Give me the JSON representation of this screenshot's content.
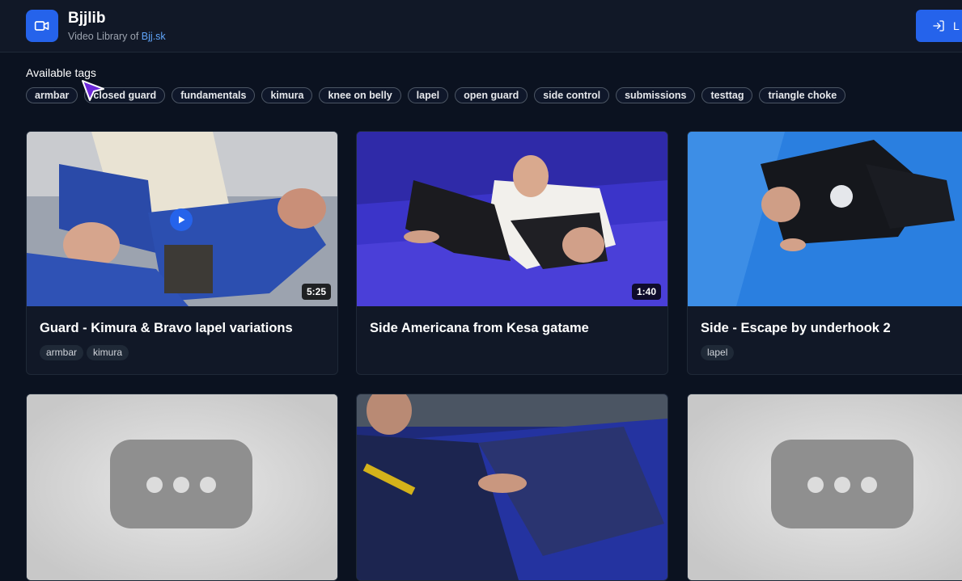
{
  "app": {
    "title": "Bjjlib",
    "subtitle_prefix": "Video Library of ",
    "subtitle_link": "Bjj.sk",
    "login_label": "L"
  },
  "tags": {
    "heading": "Available tags",
    "items": [
      "armbar",
      "closed guard",
      "fundamentals",
      "kimura",
      "knee on belly",
      "lapel",
      "open guard",
      "side control",
      "submissions",
      "testtag",
      "triangle choke"
    ]
  },
  "videos": [
    {
      "title": "Guard - Kimura & Bravo lapel variations",
      "duration": "5:25",
      "tags": [
        "armbar",
        "kimura"
      ]
    },
    {
      "title": "Side Americana from Kesa gatame",
      "duration": "1:40",
      "tags": []
    },
    {
      "title": "Side - Escape by underhook 2",
      "duration": "",
      "tags": [
        "lapel"
      ]
    },
    {
      "title": "",
      "duration": "",
      "tags": []
    },
    {
      "title": "",
      "duration": "",
      "tags": []
    },
    {
      "title": "",
      "duration": "",
      "tags": []
    }
  ],
  "colors": {
    "accent": "#2563eb",
    "background": "#0b1220",
    "card": "#111827"
  }
}
